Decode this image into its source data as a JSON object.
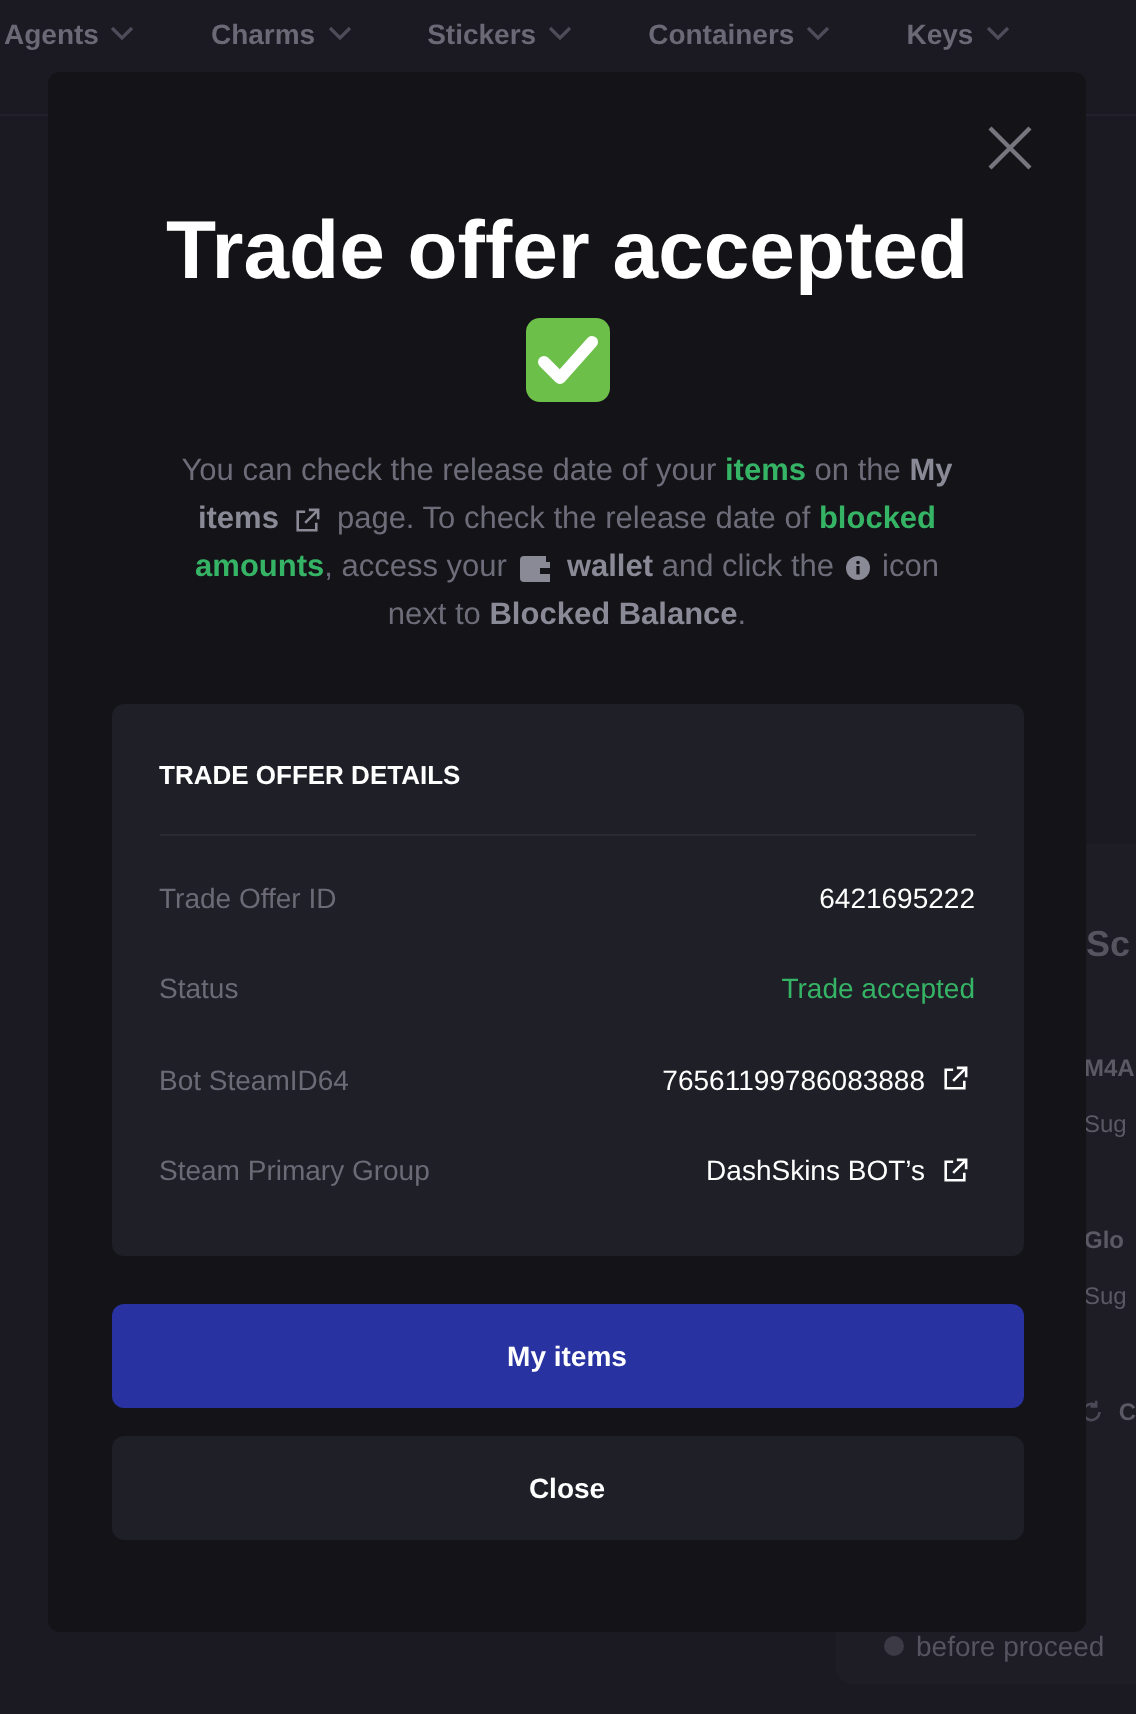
{
  "nav": [
    {
      "label": "Agents"
    },
    {
      "label": "Charms"
    },
    {
      "label": "Stickers"
    },
    {
      "label": "Containers"
    },
    {
      "label": "Keys"
    }
  ],
  "side": {
    "heading": "Sc",
    "items": [
      {
        "name": "M4A",
        "sub": "Sug"
      },
      {
        "name": "Glo",
        "sub": "Sug"
      }
    ],
    "action": "C",
    "note": "before proceed"
  },
  "modal": {
    "title": "Trade offer accepted",
    "message": [
      [
        {
          "kind": "text",
          "text": "You can check the release date of your *items* on the **My**"
        }
      ],
      [
        {
          "kind": "text",
          "text": "**items**"
        },
        {
          "kind": "external"
        },
        {
          "kind": "text",
          "text": "page. To check the release date of *blocked*"
        }
      ],
      [
        {
          "kind": "text",
          "text": "*amounts*, access your"
        },
        {
          "kind": "wallet"
        },
        {
          "kind": "text",
          "text": "**wallet** and click the"
        },
        {
          "kind": "info"
        },
        {
          "kind": "text",
          "text": "icon"
        }
      ],
      [
        {
          "kind": "text",
          "text": "next to **Blocked Balance**."
        }
      ]
    ],
    "details": {
      "heading": "TRADE OFFER DETAILS",
      "rows": [
        {
          "label": "Trade Offer ID",
          "value": "6421695222",
          "kind": "plain"
        },
        {
          "label": "Status",
          "value": "Trade accepted",
          "kind": "status"
        },
        {
          "label": "Bot SteamID64",
          "value": "76561199786083888",
          "kind": "link"
        },
        {
          "label": "Steam Primary Group",
          "value": "DashSkins BOT’s",
          "kind": "link"
        }
      ]
    },
    "buttons": [
      {
        "label": "My items",
        "kind": "primary"
      },
      {
        "label": "Close",
        "kind": "secondary"
      }
    ]
  }
}
